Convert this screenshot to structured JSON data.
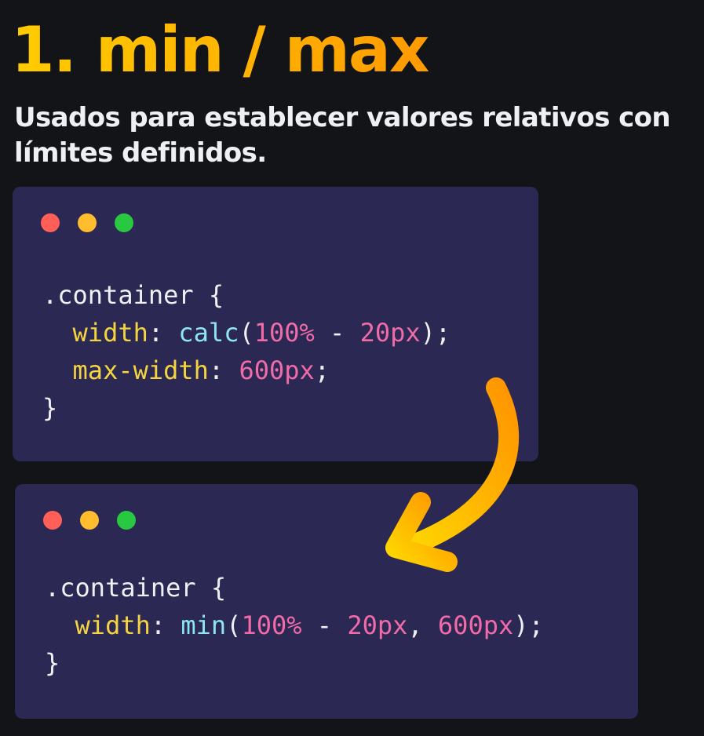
{
  "title": "1. min / max",
  "subtitle": "Usados para establecer valores relativos con límites definidos.",
  "colors": {
    "background": "#131418",
    "window": "#2b2853",
    "dot_red": "#ff5f57",
    "dot_yellow": "#febc2e",
    "dot_green": "#28c840",
    "property": "#f5d442",
    "function": "#8ee6f0",
    "number": "#f06ba8",
    "arrow_start": "#ffd600",
    "arrow_end": "#ff9500"
  },
  "snippet_before": {
    "selector": ".container {",
    "line1_prop": "width",
    "line1_colon": ": ",
    "line1_func": "calc",
    "line1_open": "(",
    "line1_val1": "100%",
    "line1_op": " - ",
    "line1_val2": "20px",
    "line1_end": ");",
    "line2_prop": "max-width",
    "line2_colon": ": ",
    "line2_val": "600px",
    "line2_end": ";",
    "close": "}"
  },
  "snippet_after": {
    "selector": ".container {",
    "line1_prop": "width",
    "line1_colon": ": ",
    "line1_func": "min",
    "line1_open": "(",
    "line1_val1": "100%",
    "line1_op": " - ",
    "line1_val2": "20px",
    "line1_sep": ", ",
    "line1_val3": "600px",
    "line1_end": ");",
    "close": "}"
  },
  "icons": {
    "window_controls": "traffic-light-dots",
    "transition": "curved-arrow-down-left"
  }
}
